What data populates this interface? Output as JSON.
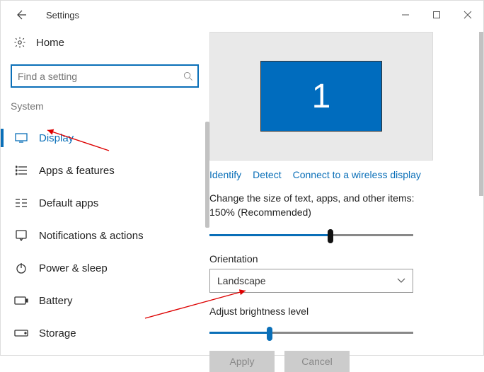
{
  "title": "Settings",
  "search": {
    "placeholder": "Find a setting"
  },
  "section": "System",
  "home": "Home",
  "nav": {
    "items": [
      {
        "label": "Display"
      },
      {
        "label": "Apps & features"
      },
      {
        "label": "Default apps"
      },
      {
        "label": "Notifications & actions"
      },
      {
        "label": "Power & sleep"
      },
      {
        "label": "Battery"
      },
      {
        "label": "Storage"
      }
    ]
  },
  "monitor": {
    "number": "1"
  },
  "links": {
    "identify": "Identify",
    "detect": "Detect",
    "wireless": "Connect to a wireless display"
  },
  "size": {
    "label": "Change the size of text, apps, and other items: 150% (Recommended)",
    "percent": 58
  },
  "orientation": {
    "label": "Orientation",
    "value": "Landscape"
  },
  "brightness": {
    "label": "Adjust brightness level",
    "percent": 28
  },
  "buttons": {
    "apply": "Apply",
    "cancel": "Cancel"
  }
}
